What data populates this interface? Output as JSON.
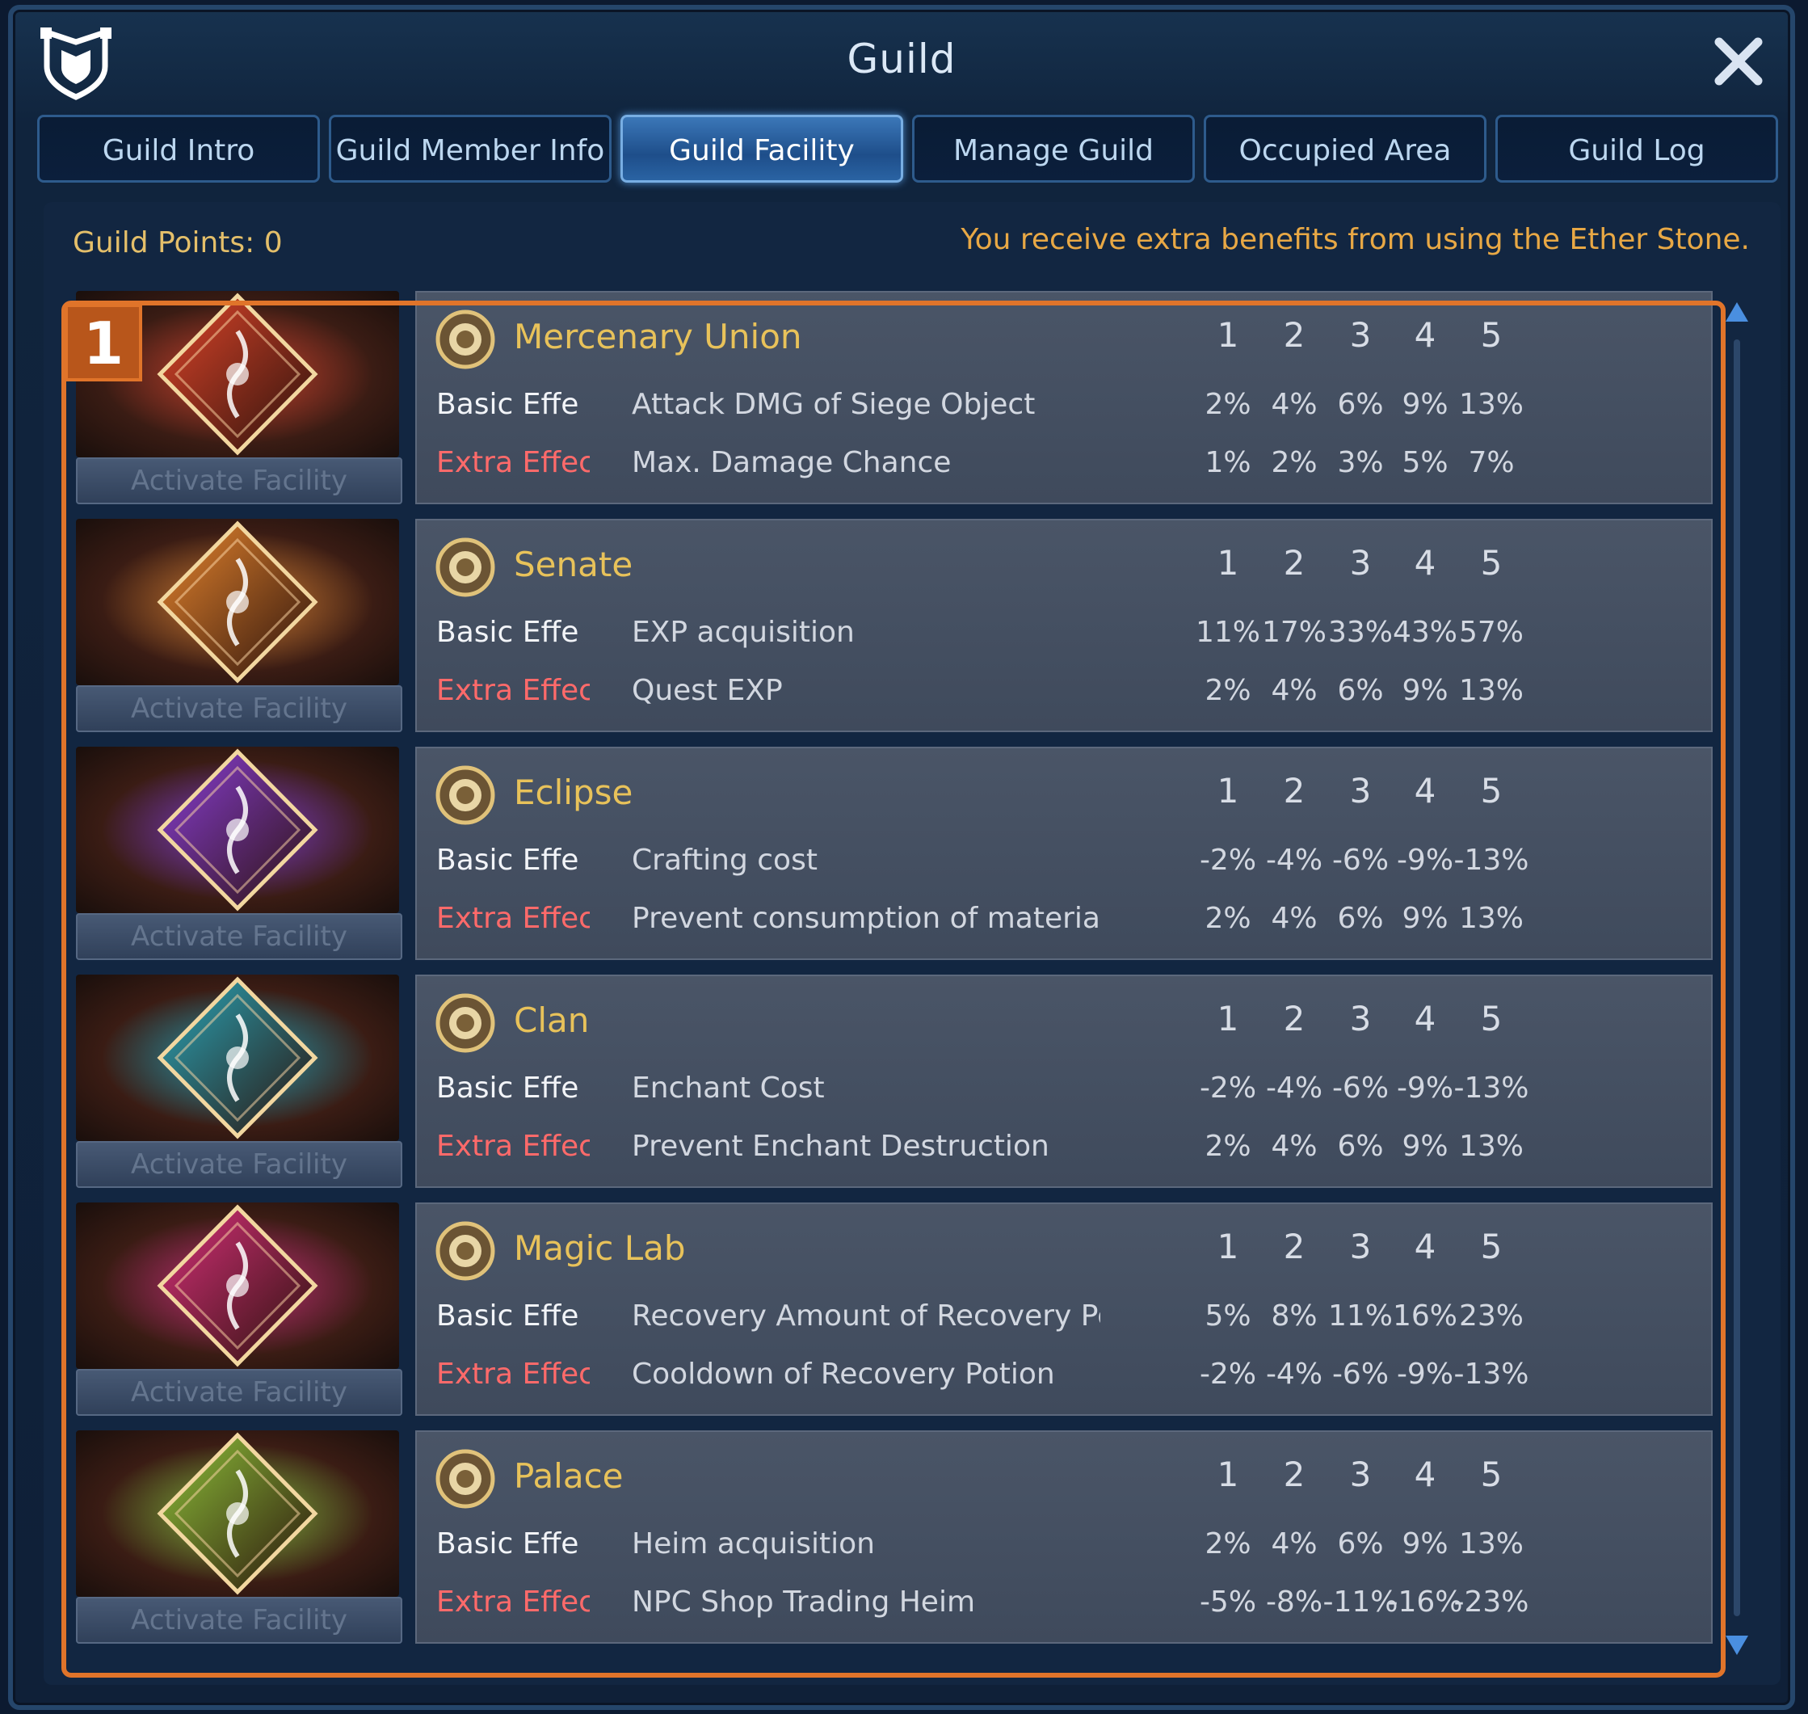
{
  "window": {
    "title": "Guild"
  },
  "tabs": [
    {
      "label": "Guild Intro"
    },
    {
      "label": "Guild Member Info"
    },
    {
      "label": "Guild Facility",
      "active": true
    },
    {
      "label": "Manage Guild"
    },
    {
      "label": "Occupied Area"
    },
    {
      "label": "Guild Log"
    }
  ],
  "guild_points": "Guild Points: 0",
  "ether_note": "You receive extra benefits from using the Ether Stone.",
  "annotation_badge": "1",
  "levels": [
    "1",
    "2",
    "3",
    "4",
    "5"
  ],
  "activate_label": "Activate Facility",
  "basic_label": "Basic Effe",
  "extra_label": "Extra Effec",
  "facilities": [
    {
      "name": "Mercenary Union",
      "icon": "mercenary-union-emblem-icon",
      "color": "#e0452a",
      "basic": {
        "desc": "Attack DMG of Siege Object",
        "values": [
          "2%",
          "4%",
          "6%",
          "9%",
          "13%"
        ]
      },
      "extra": {
        "desc": "Max. Damage Chance",
        "values": [
          "1%",
          "2%",
          "3%",
          "5%",
          "7%"
        ]
      }
    },
    {
      "name": "Senate",
      "icon": "senate-griffin-emblem-icon",
      "color": "#e8862e",
      "basic": {
        "desc": "EXP acquisition",
        "values": [
          "11%",
          "17%",
          "33%",
          "43%",
          "57%"
        ]
      },
      "extra": {
        "desc": "Quest EXP",
        "values": [
          "2%",
          "4%",
          "6%",
          "9%",
          "13%"
        ]
      }
    },
    {
      "name": "Eclipse",
      "icon": "eclipse-emblem-icon",
      "color": "#8a3ed6",
      "basic": {
        "desc": "Crafting cost",
        "values": [
          "-2%",
          "-4%",
          "-6%",
          "-9%",
          "-13%"
        ]
      },
      "extra": {
        "desc": "Prevent consumption of material w",
        "values": [
          "2%",
          "4%",
          "6%",
          "9%",
          "13%"
        ]
      }
    },
    {
      "name": "Clan",
      "icon": "clan-emblem-icon",
      "color": "#2aa6b8",
      "basic": {
        "desc": "Enchant Cost",
        "values": [
          "-2%",
          "-4%",
          "-6%",
          "-9%",
          "-13%"
        ]
      },
      "extra": {
        "desc": "Prevent Enchant Destruction",
        "values": [
          "2%",
          "4%",
          "6%",
          "9%",
          "13%"
        ]
      }
    },
    {
      "name": "Magic Lab",
      "icon": "magic-lab-emblem-icon",
      "color": "#d8307a",
      "basic": {
        "desc": "Recovery Amount of Recovery Po",
        "values": [
          "5%",
          "8%",
          "11%",
          "16%",
          "23%"
        ]
      },
      "extra": {
        "desc": "Cooldown of Recovery Potion",
        "values": [
          "-2%",
          "-4%",
          "-6%",
          "-9%",
          "-13%"
        ]
      }
    },
    {
      "name": "Palace",
      "icon": "palace-emblem-icon",
      "color": "#8ec23a",
      "basic": {
        "desc": "Heim acquisition",
        "values": [
          "2%",
          "4%",
          "6%",
          "9%",
          "13%"
        ]
      },
      "extra": {
        "desc": "NPC Shop Trading Heim",
        "values": [
          "-5%",
          "-8%",
          "-11%",
          "-16%",
          "-23%"
        ]
      }
    }
  ],
  "colors": {
    "accent_orange": "#e0742a",
    "name_gold": "#e8c25a",
    "extra_red": "#ff6a6a",
    "active_tab": "#2a63a3"
  }
}
